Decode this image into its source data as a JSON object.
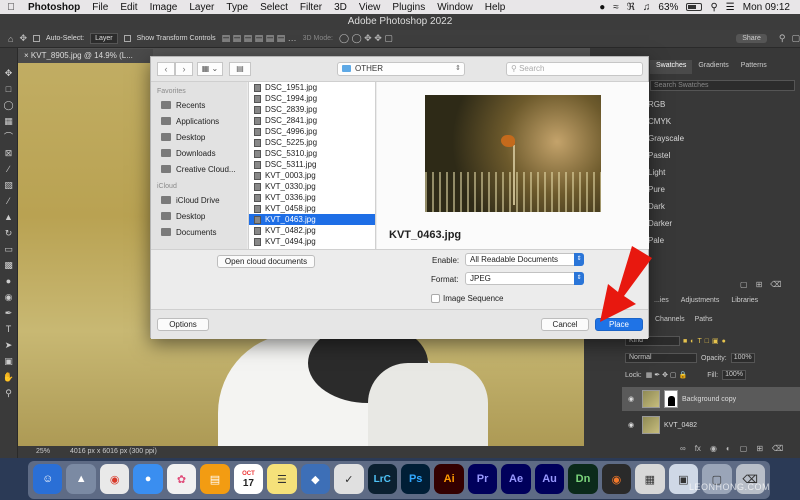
{
  "menubar": {
    "app": "Photoshop",
    "items": [
      "File",
      "Edit",
      "Image",
      "Layer",
      "Type",
      "Select",
      "Filter",
      "3D",
      "View",
      "Plugins",
      "Window",
      "Help"
    ],
    "battery": "63%",
    "clock": "Mon 09:12"
  },
  "window_title": "Adobe Photoshop 2022",
  "options_bar": {
    "auto_select": "Auto-Select:",
    "auto_select_value": "Layer",
    "show_transform": "Show Transform Controls",
    "mode_3d": "3D Mode:",
    "share": "Share"
  },
  "doc_tab": "KVT_8905.jpg @ 14.9% (L...",
  "status": {
    "zoom": "25%",
    "info": "4016 px x 6016 px (300 ppi)"
  },
  "swatches": {
    "tabs": [
      "Swatches",
      "Gradients",
      "Patterns"
    ],
    "search_placeholder": "Search Swatches",
    "groups": [
      "RGB",
      "CMYK",
      "Grayscale",
      "Pastel",
      "Light",
      "Pure",
      "Dark",
      "Darker",
      "Pale"
    ]
  },
  "layers_panel": {
    "tabs": [
      "...ies",
      "Adjustments",
      "Libraries"
    ],
    "subtabs": [
      "Channels",
      "Paths"
    ],
    "kind": "Kind",
    "blend_mode": "Normal",
    "opacity_label": "Opacity:",
    "opacity": "100%",
    "lock_label": "Lock:",
    "fill_label": "Fill:",
    "fill": "100%",
    "layers": [
      {
        "name": "Background copy",
        "selected": true
      },
      {
        "name": "KVT_0482",
        "selected": false
      }
    ]
  },
  "dialog": {
    "location": "OTHER",
    "search_placeholder": "Search",
    "sidebar": {
      "favorites_header": "Favorites",
      "favorites": [
        "Recents",
        "Applications",
        "Desktop",
        "Downloads",
        "Creative Cloud..."
      ],
      "icloud_header": "iCloud",
      "icloud": [
        "iCloud Drive",
        "Desktop",
        "Documents"
      ]
    },
    "files": [
      "DSC_1951.jpg",
      "DSC_1994.jpg",
      "DSC_2839.jpg",
      "DSC_2841.jpg",
      "DSC_4996.jpg",
      "DSC_5225.jpg",
      "DSC_5310.jpg",
      "DSC_5311.jpg",
      "KVT_0003.jpg",
      "KVT_0330.jpg",
      "KVT_0336.jpg",
      "KVT_0458.jpg",
      "KVT_0463.jpg",
      "KVT_0482.jpg",
      "KVT_0494.jpg"
    ],
    "selected_file": "KVT_0463.jpg",
    "preview_filename": "KVT_0463.jpg",
    "open_cloud_button": "Open cloud documents",
    "enable_label": "Enable:",
    "enable_value": "All Readable Documents",
    "format_label": "Format:",
    "format_value": "JPEG",
    "image_sequence_label": "Image Sequence",
    "options_button": "Options",
    "cancel_button": "Cancel",
    "place_button": "Place"
  },
  "dock": {
    "apps": [
      "",
      "",
      "",
      "",
      "",
      "",
      "17",
      "",
      "",
      "",
      "LrC",
      "Ps",
      "Ai",
      "Pr",
      "Ae",
      "Au",
      "Dn",
      "",
      "",
      "",
      "",
      ""
    ],
    "calendar_month": "OCT"
  },
  "watermark": "LEONHONG.COM",
  "colors": {
    "accent": "#1f73e6",
    "arrow": "#e8180f"
  }
}
